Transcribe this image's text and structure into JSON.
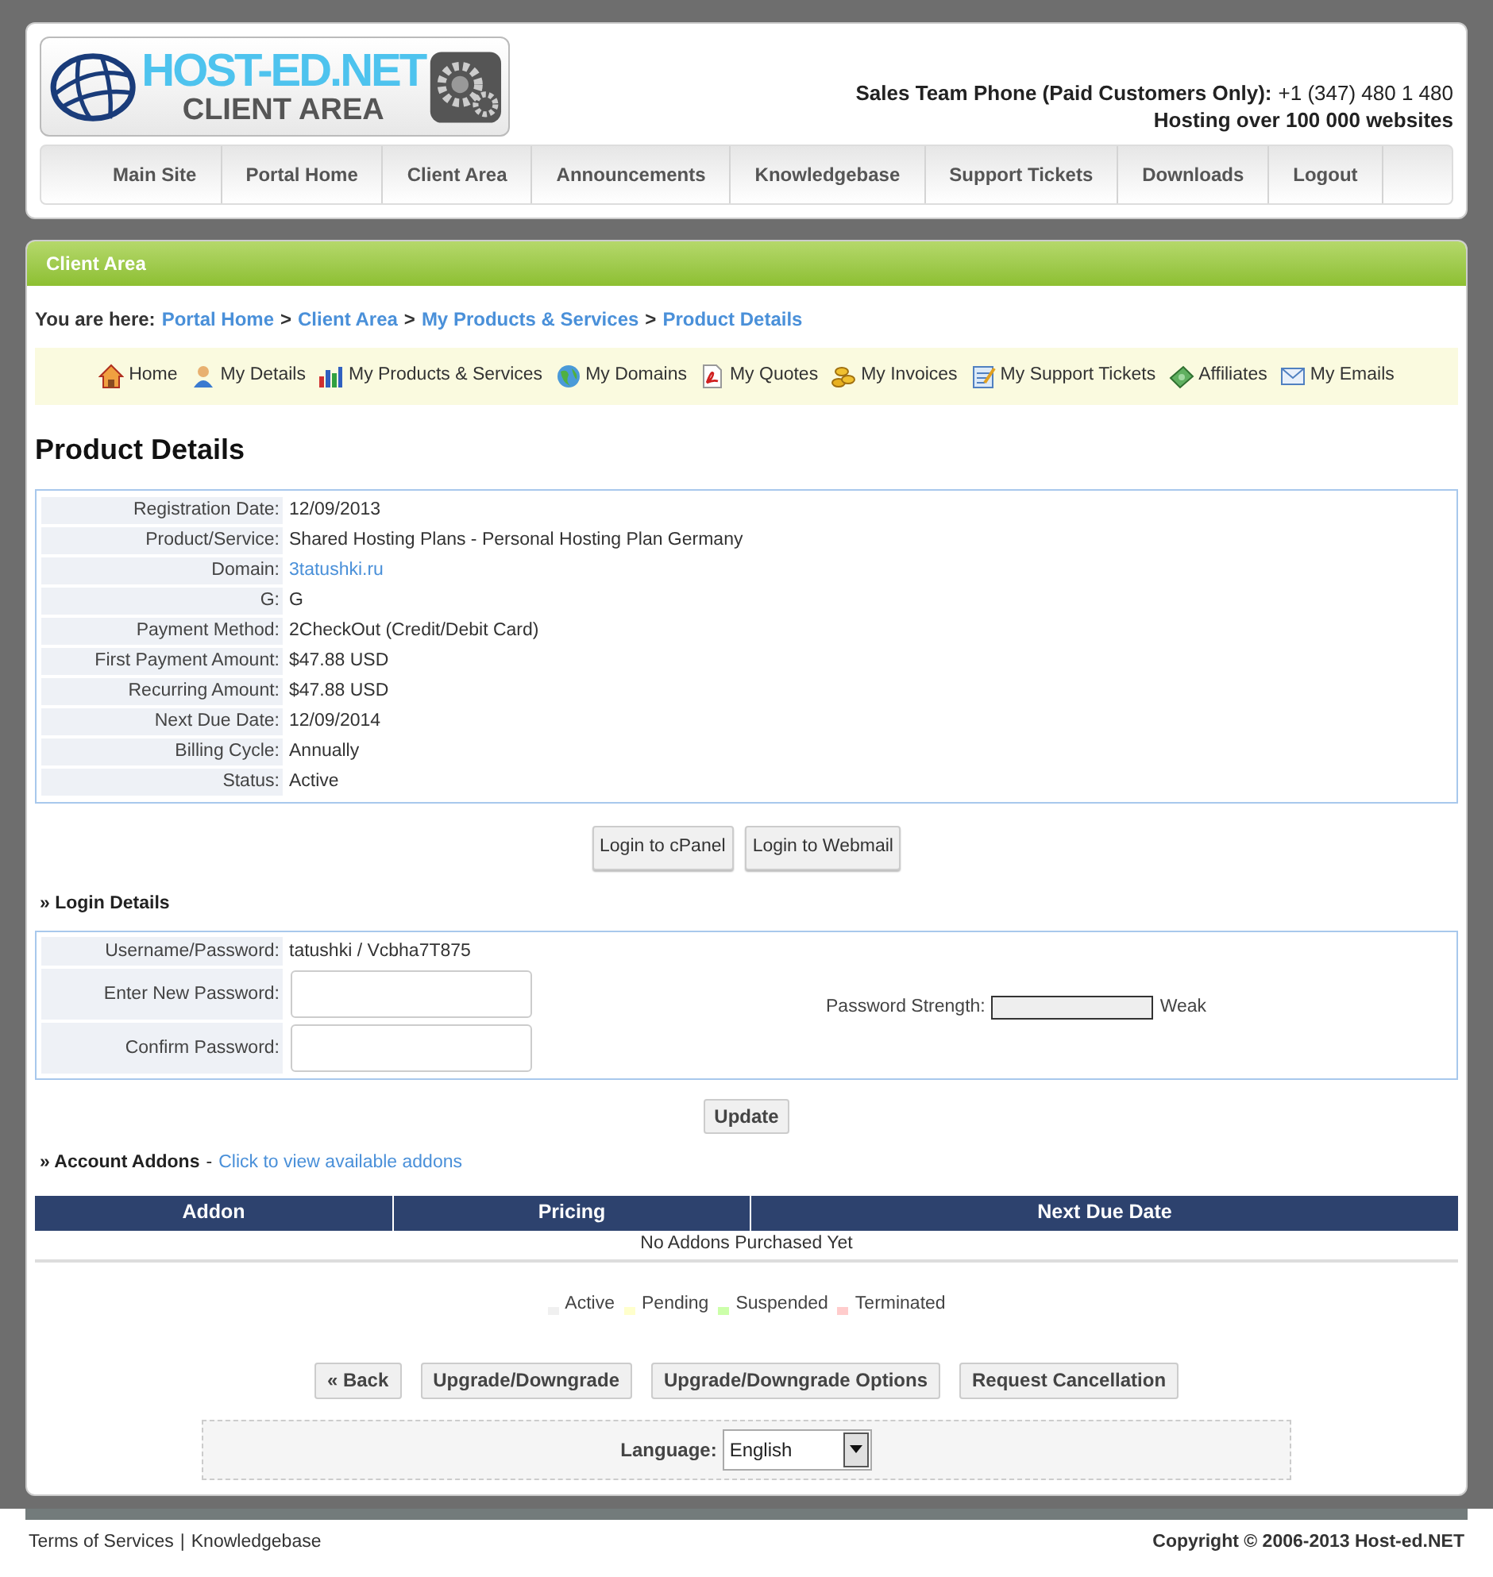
{
  "logo": {
    "title": "HOST-ED.NET",
    "subtitle": "CLIENT AREA"
  },
  "header": {
    "phone_label": "Sales Team Phone (Paid Customers Only):",
    "phone": "+1 (347) 480 1 480",
    "tagline": "Hosting over 100 000 websites"
  },
  "nav": [
    "Main Site",
    "Portal Home",
    "Client Area",
    "Announcements",
    "Knowledgebase",
    "Support Tickets",
    "Downloads",
    "Logout"
  ],
  "panel_title": "Client Area",
  "breadcrumb": {
    "label": "You are here:",
    "items": [
      "Portal Home",
      "Client Area",
      "My Products & Services",
      "Product Details"
    ],
    "separator": ">"
  },
  "quick_links": [
    {
      "kind": "home",
      "label": "Home"
    },
    {
      "kind": "person",
      "label": "My Details"
    },
    {
      "kind": "chart",
      "label": "My Products & Services"
    },
    {
      "kind": "globe",
      "label": "My Domains"
    },
    {
      "kind": "pdf",
      "label": "My Quotes"
    },
    {
      "kind": "coins",
      "label": "My Invoices"
    },
    {
      "kind": "note",
      "label": "My Support Tickets"
    },
    {
      "kind": "money",
      "label": "Affiliates"
    },
    {
      "kind": "mail",
      "label": "My Emails"
    }
  ],
  "page_title": "Product Details",
  "details": [
    {
      "label": "Registration Date:",
      "value": "12/09/2013",
      "kind": "text"
    },
    {
      "label": "Product/Service:",
      "value": "Shared Hosting Plans - Personal Hosting Plan Germany",
      "kind": "text"
    },
    {
      "label": "Domain:",
      "value": "3tatushki.ru",
      "kind": "link"
    },
    {
      "label": "G:",
      "value": "G",
      "kind": "text"
    },
    {
      "label": "Payment Method:",
      "value": "2CheckOut (Credit/Debit Card)",
      "kind": "text"
    },
    {
      "label": "First Payment Amount:",
      "value": "$47.88 USD",
      "kind": "text"
    },
    {
      "label": "Recurring Amount:",
      "value": "$47.88 USD",
      "kind": "text"
    },
    {
      "label": "Next Due Date:",
      "value": "12/09/2014",
      "kind": "text"
    },
    {
      "label": "Billing Cycle:",
      "value": "Annually",
      "kind": "text"
    },
    {
      "label": "Status:",
      "value": "Active",
      "kind": "text"
    }
  ],
  "login_buttons": [
    "Login to cPanel",
    "Login to Webmail"
  ],
  "login_details": {
    "heading": "» Login Details",
    "rows": [
      {
        "label": "Username/Password:",
        "value": "tatushki / Vcbha7T875",
        "kind": "text"
      },
      {
        "label": "Enter New Password:",
        "kind": "input"
      },
      {
        "label": "Confirm Password:",
        "kind": "input"
      }
    ],
    "strength": {
      "label": "Password Strength:",
      "level": 0,
      "reading": "Weak"
    },
    "button": "Update"
  },
  "addons": {
    "heading": "» Account Addons",
    "separator": "-",
    "link": "Click to view available addons",
    "columns": [
      "Addon",
      "Pricing",
      "Next Due Date"
    ],
    "empty": "No Addons Purchased Yet"
  },
  "legend": [
    {
      "label": "Active",
      "color": "#f0f0f0"
    },
    {
      "label": "Pending",
      "color": "#ffffcc"
    },
    {
      "label": "Suspended",
      "color": "#ccffaa"
    },
    {
      "label": "Terminated",
      "color": "#ffcccc"
    }
  ],
  "actions": [
    "« Back",
    "Upgrade/Downgrade",
    "Upgrade/Downgrade Options",
    "Request Cancellation"
  ],
  "language": {
    "label": "Language:",
    "value": "English"
  },
  "footer": {
    "links": [
      "Terms of Services",
      "Knowledgebase"
    ],
    "separator": "|",
    "copyright": "Copyright © 2006-2013 Host-ed.NET"
  }
}
